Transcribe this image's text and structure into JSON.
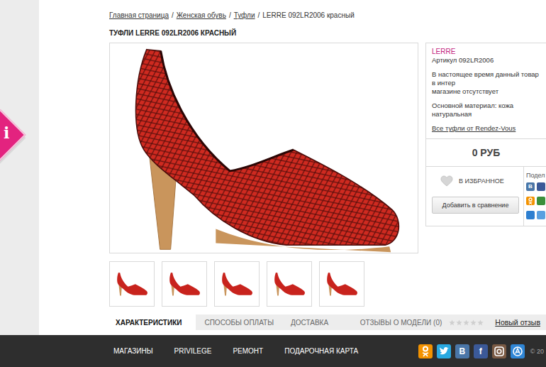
{
  "sidebar_badge": {
    "glyph": "i"
  },
  "breadcrumb": {
    "separator": "/",
    "items": [
      {
        "label": "Главная страница",
        "link": true
      },
      {
        "label": "Женская обувь",
        "link": true
      },
      {
        "label": "Туфли",
        "link": true
      },
      {
        "label": "LERRE 092LR2006 красный",
        "link": false
      }
    ]
  },
  "title": "ТУФЛИ LERRE 092LR2006 КРАСНЫЙ",
  "product_info": {
    "brand": "LERRE",
    "article": "Артикул 092LR2006",
    "availability_lines": [
      "В настоящее время данный товар в интер",
      "магазине отсутствует"
    ],
    "material": "Основной материал: кожа натуральная",
    "all_link": "Все туфли от Rendez-Vous"
  },
  "price": "0 РУБ",
  "favorite": {
    "label": "В ИЗБРАННОЕ",
    "on": false
  },
  "compare_button": "Добавить в сравнение",
  "share": {
    "label": "Подел",
    "icons": [
      {
        "kind": "glyph",
        "glyph": "В",
        "color": "#4a76a8"
      },
      {
        "kind": "plain",
        "color": "#3b5998"
      },
      {
        "kind": "ok",
        "color": "#f39200"
      },
      {
        "kind": "plain",
        "color": "#3b8f3b"
      },
      {
        "kind": "plain",
        "color": "#2d7fd0"
      },
      {
        "kind": "plain",
        "color": "#5aa0e0"
      }
    ]
  },
  "tabs": [
    {
      "label": "ХАРАКТЕРИСТИКИ",
      "selected": true
    },
    {
      "label": "СПОСОБЫ ОПЛАТЫ",
      "selected": false
    },
    {
      "label": "ДОСТАВКА",
      "selected": false
    }
  ],
  "reviews": {
    "label": "ОТЗЫВЫ О МОДЕЛИ (0)",
    "stars": 0,
    "new_review": "Новый отзыв"
  },
  "footer": {
    "links": [
      "МАГАЗИНЫ",
      "PRIVILEGE",
      "РЕМОНТ",
      "ПОДАРОЧНАЯ КАРТА"
    ],
    "social": [
      {
        "kind": "ok",
        "color": "#f39200"
      },
      {
        "kind": "bird",
        "color": "#29a9e1"
      },
      {
        "kind": "glyph",
        "glyph": "В",
        "color": "#4a76a8"
      },
      {
        "kind": "glyph",
        "glyph": "f",
        "color": "#3b5998"
      },
      {
        "kind": "camera",
        "color": "#7a5a44"
      },
      {
        "kind": "app",
        "color": "#2f86d6"
      }
    ],
    "copyright": "© 20"
  }
}
